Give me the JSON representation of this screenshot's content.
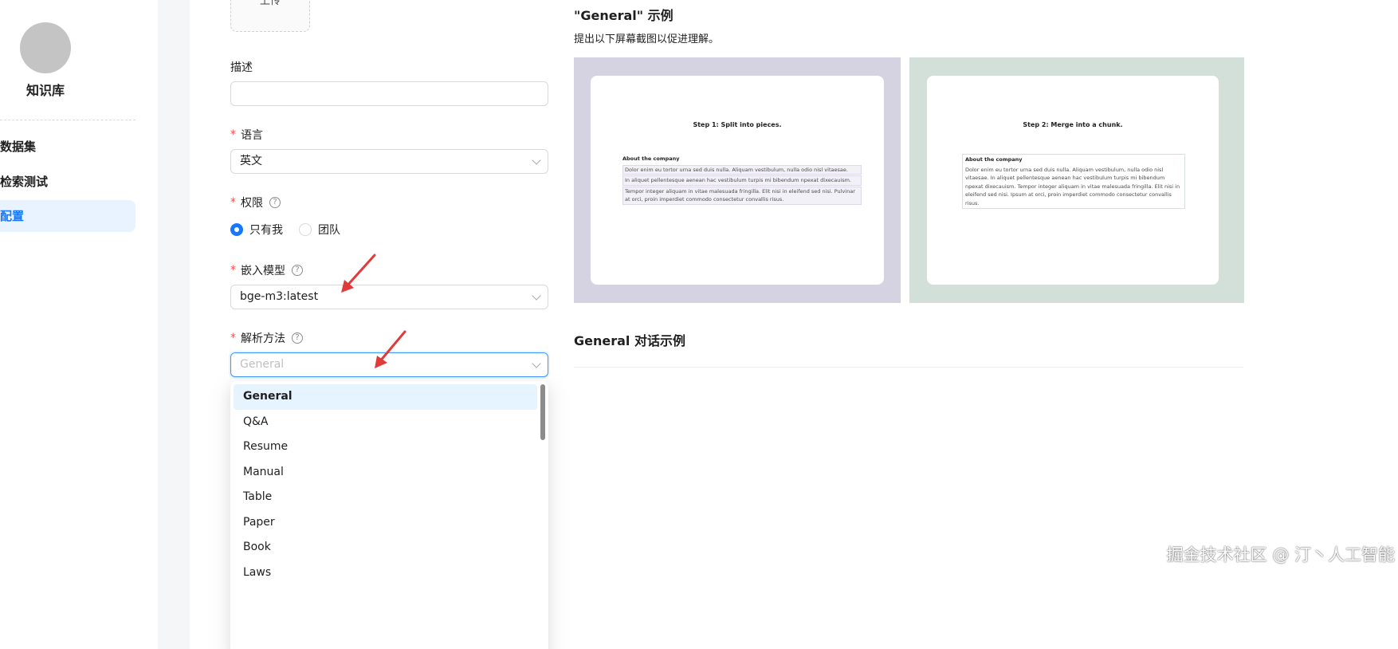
{
  "sidebar": {
    "kb_name": "知识库",
    "items": [
      {
        "label": "数据集"
      },
      {
        "label": "检索测试"
      },
      {
        "label": "配置"
      }
    ]
  },
  "form": {
    "upload_label": "上传",
    "description_label": "描述",
    "description_value": "",
    "language_label": "语言",
    "language_value": "英文",
    "permission_label": "权限",
    "permission_options": [
      "只有我",
      "团队"
    ],
    "permission_selected": "只有我",
    "embedding_label": "嵌入模型",
    "embedding_value": "bge-m3:latest",
    "parser_label": "解析方法",
    "parser_placeholder": "General",
    "parser_options": [
      "General",
      "Q&A",
      "Resume",
      "Manual",
      "Table",
      "Paper",
      "Book",
      "Laws"
    ]
  },
  "example": {
    "title": "\"General\" 示例",
    "subtitle": "提出以下屏幕截图以促进理解。",
    "step1": "Step 1: Split into pieces.",
    "step2": "Step 2: Merge into a chunk.",
    "doc_heading": "About the company",
    "chunks": [
      "Dolor enim eu tortor urna sed duis nulla. Aliquam vestibulum, nulla odio nisl vitaesae.",
      "In aliquet pellentesque aenean hac vestibulum turpis mi bibendum npexat dixecauism.",
      "Tempor integer aliquam in vitae malesuada fringilla. Elit nisi in eleifend sed nisi. Pulvinar at orci, proin imperdiet commodo consectetur convallis risus."
    ],
    "merged": "Dolor enim eu tortor urna sed duis nulla. Aliquam vestibulum, nulla odio nisl vitaesae. In aliquet pellentesque aenean hac vestibulum turpis mi bibendum npexat dixecauism. Tempor integer aliquam in vitae malesuada fringilla. Elit nisi in eleifend sed nisi. Ipsum at orci, proin imperdiet commodo consectetur convallis risus.",
    "chat_title": "General 对话示例"
  },
  "watermark": "掘金技术社区 @ 汀丶人工智能",
  "colors": {
    "accent": "#1677ff",
    "active_bg": "#e8f3ff",
    "required": "#ff4d4f",
    "arrow": "#e03a3a"
  }
}
